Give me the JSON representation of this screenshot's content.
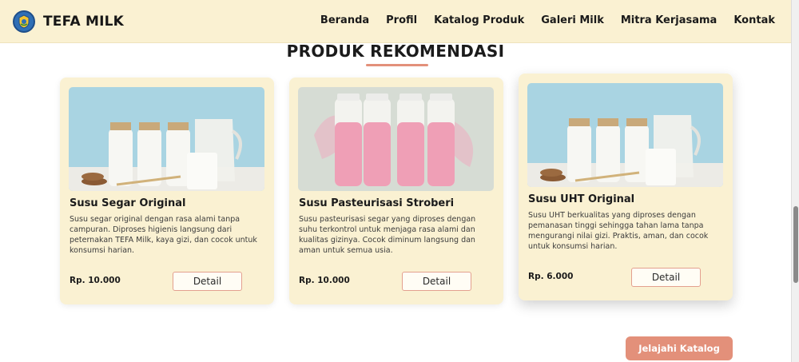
{
  "navbar": {
    "brand": "TEFA MILK",
    "logo_icon": "school-emblem-icon",
    "links": [
      "Beranda",
      "Profil",
      "Katalog Produk",
      "Galeri Milk",
      "Mitra Kerjasama",
      "Kontak"
    ]
  },
  "section": {
    "title": "PRODUK REKOMENDASI"
  },
  "products": [
    {
      "title": "Susu Segar Original",
      "description": "Susu segar original dengan rasa alami tanpa campuran. Diproses higienis langsung dari peternakan TEFA Milk, kaya gizi, dan cocok untuk konsumsi harian.",
      "price": "Rp. 10.000",
      "button": "Detail",
      "image_icon": "milk-bottles-image"
    },
    {
      "title": "Susu Pasteurisasi Stroberi",
      "description": "Susu pasteurisasi segar yang diproses dengan suhu terkontrol untuk menjaga rasa alami dan kualitas gizinya. Cocok diminum langsung dan aman untuk semua usia.",
      "price": "Rp. 10.000",
      "button": "Detail",
      "image_icon": "strawberry-milk-bottles-image"
    },
    {
      "title": "Susu UHT Original",
      "description": "Susu UHT berkualitas yang diproses dengan pemanasan tinggi sehingga tahan lama tanpa mengurangi nilai gizi. Praktis, aman, dan cocok untuk konsumsi harian.",
      "price": "Rp. 6.000",
      "button": "Detail",
      "image_icon": "milk-bottles-image"
    }
  ],
  "cta": {
    "label": "Jelajahi Katalog"
  },
  "colors": {
    "navbar_bg": "#faf1d2",
    "card_bg": "#faf1d2",
    "accent": "#e3907a"
  }
}
